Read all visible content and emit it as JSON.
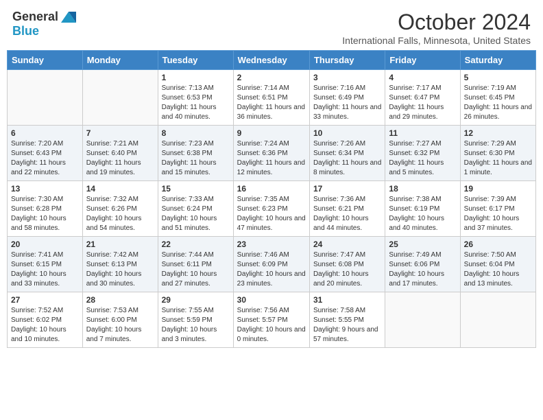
{
  "header": {
    "logo_line1": "General",
    "logo_line2": "Blue",
    "month": "October 2024",
    "location": "International Falls, Minnesota, United States"
  },
  "days_of_week": [
    "Sunday",
    "Monday",
    "Tuesday",
    "Wednesday",
    "Thursday",
    "Friday",
    "Saturday"
  ],
  "weeks": [
    [
      {
        "day": "",
        "info": ""
      },
      {
        "day": "",
        "info": ""
      },
      {
        "day": "1",
        "info": "Sunrise: 7:13 AM\nSunset: 6:53 PM\nDaylight: 11 hours and 40 minutes."
      },
      {
        "day": "2",
        "info": "Sunrise: 7:14 AM\nSunset: 6:51 PM\nDaylight: 11 hours and 36 minutes."
      },
      {
        "day": "3",
        "info": "Sunrise: 7:16 AM\nSunset: 6:49 PM\nDaylight: 11 hours and 33 minutes."
      },
      {
        "day": "4",
        "info": "Sunrise: 7:17 AM\nSunset: 6:47 PM\nDaylight: 11 hours and 29 minutes."
      },
      {
        "day": "5",
        "info": "Sunrise: 7:19 AM\nSunset: 6:45 PM\nDaylight: 11 hours and 26 minutes."
      }
    ],
    [
      {
        "day": "6",
        "info": "Sunrise: 7:20 AM\nSunset: 6:43 PM\nDaylight: 11 hours and 22 minutes."
      },
      {
        "day": "7",
        "info": "Sunrise: 7:21 AM\nSunset: 6:40 PM\nDaylight: 11 hours and 19 minutes."
      },
      {
        "day": "8",
        "info": "Sunrise: 7:23 AM\nSunset: 6:38 PM\nDaylight: 11 hours and 15 minutes."
      },
      {
        "day": "9",
        "info": "Sunrise: 7:24 AM\nSunset: 6:36 PM\nDaylight: 11 hours and 12 minutes."
      },
      {
        "day": "10",
        "info": "Sunrise: 7:26 AM\nSunset: 6:34 PM\nDaylight: 11 hours and 8 minutes."
      },
      {
        "day": "11",
        "info": "Sunrise: 7:27 AM\nSunset: 6:32 PM\nDaylight: 11 hours and 5 minutes."
      },
      {
        "day": "12",
        "info": "Sunrise: 7:29 AM\nSunset: 6:30 PM\nDaylight: 11 hours and 1 minute."
      }
    ],
    [
      {
        "day": "13",
        "info": "Sunrise: 7:30 AM\nSunset: 6:28 PM\nDaylight: 10 hours and 58 minutes."
      },
      {
        "day": "14",
        "info": "Sunrise: 7:32 AM\nSunset: 6:26 PM\nDaylight: 10 hours and 54 minutes."
      },
      {
        "day": "15",
        "info": "Sunrise: 7:33 AM\nSunset: 6:24 PM\nDaylight: 10 hours and 51 minutes."
      },
      {
        "day": "16",
        "info": "Sunrise: 7:35 AM\nSunset: 6:23 PM\nDaylight: 10 hours and 47 minutes."
      },
      {
        "day": "17",
        "info": "Sunrise: 7:36 AM\nSunset: 6:21 PM\nDaylight: 10 hours and 44 minutes."
      },
      {
        "day": "18",
        "info": "Sunrise: 7:38 AM\nSunset: 6:19 PM\nDaylight: 10 hours and 40 minutes."
      },
      {
        "day": "19",
        "info": "Sunrise: 7:39 AM\nSunset: 6:17 PM\nDaylight: 10 hours and 37 minutes."
      }
    ],
    [
      {
        "day": "20",
        "info": "Sunrise: 7:41 AM\nSunset: 6:15 PM\nDaylight: 10 hours and 33 minutes."
      },
      {
        "day": "21",
        "info": "Sunrise: 7:42 AM\nSunset: 6:13 PM\nDaylight: 10 hours and 30 minutes."
      },
      {
        "day": "22",
        "info": "Sunrise: 7:44 AM\nSunset: 6:11 PM\nDaylight: 10 hours and 27 minutes."
      },
      {
        "day": "23",
        "info": "Sunrise: 7:46 AM\nSunset: 6:09 PM\nDaylight: 10 hours and 23 minutes."
      },
      {
        "day": "24",
        "info": "Sunrise: 7:47 AM\nSunset: 6:08 PM\nDaylight: 10 hours and 20 minutes."
      },
      {
        "day": "25",
        "info": "Sunrise: 7:49 AM\nSunset: 6:06 PM\nDaylight: 10 hours and 17 minutes."
      },
      {
        "day": "26",
        "info": "Sunrise: 7:50 AM\nSunset: 6:04 PM\nDaylight: 10 hours and 13 minutes."
      }
    ],
    [
      {
        "day": "27",
        "info": "Sunrise: 7:52 AM\nSunset: 6:02 PM\nDaylight: 10 hours and 10 minutes."
      },
      {
        "day": "28",
        "info": "Sunrise: 7:53 AM\nSunset: 6:00 PM\nDaylight: 10 hours and 7 minutes."
      },
      {
        "day": "29",
        "info": "Sunrise: 7:55 AM\nSunset: 5:59 PM\nDaylight: 10 hours and 3 minutes."
      },
      {
        "day": "30",
        "info": "Sunrise: 7:56 AM\nSunset: 5:57 PM\nDaylight: 10 hours and 0 minutes."
      },
      {
        "day": "31",
        "info": "Sunrise: 7:58 AM\nSunset: 5:55 PM\nDaylight: 9 hours and 57 minutes."
      },
      {
        "day": "",
        "info": ""
      },
      {
        "day": "",
        "info": ""
      }
    ]
  ]
}
